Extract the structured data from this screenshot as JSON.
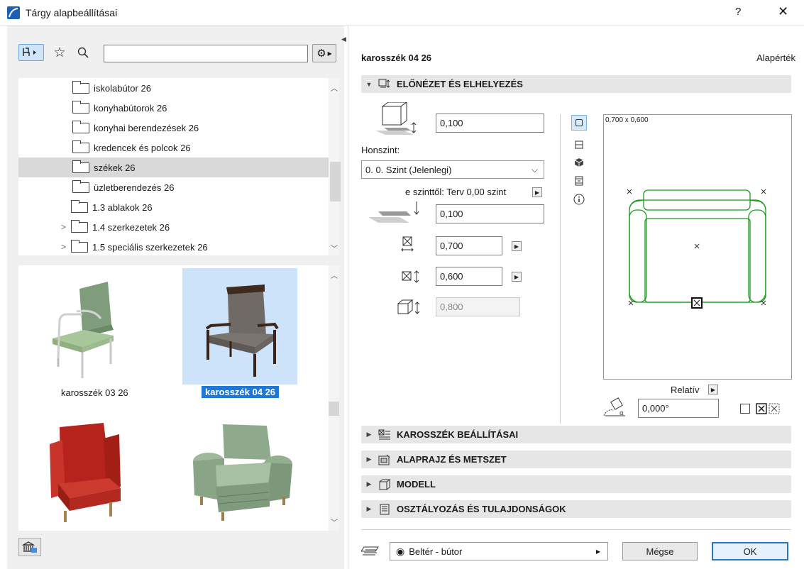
{
  "window": {
    "title": "Tárgy alapbeállításai",
    "help": "?",
    "close": "✕"
  },
  "tree": {
    "items": [
      {
        "label": "iskolabútor 26",
        "level": 3,
        "expander": ""
      },
      {
        "label": "konyhabútorok 26",
        "level": 3,
        "expander": ""
      },
      {
        "label": "konyhai berendezések 26",
        "level": 3,
        "expander": ""
      },
      {
        "label": "kredencek és polcok 26",
        "level": 3,
        "expander": ""
      },
      {
        "label": "székek 26",
        "level": 3,
        "expander": "",
        "selected": true
      },
      {
        "label": "üzletberendezés 26",
        "level": 3,
        "expander": ""
      },
      {
        "label": "1.3 ablakok 26",
        "level": 2,
        "expander": ""
      },
      {
        "label": "1.4 szerkezetek 26",
        "level": 2,
        "expander": ">"
      },
      {
        "label": "1.5 speciális szerkezetek 26",
        "level": 2,
        "expander": ">"
      }
    ]
  },
  "gallery": {
    "items": [
      {
        "caption": "karosszék 03 26",
        "selected": false
      },
      {
        "caption": "karosszék 04 26",
        "selected": true
      },
      {
        "caption": "",
        "selected": false
      },
      {
        "caption": "",
        "selected": false
      }
    ]
  },
  "object": {
    "name": "karosszék 04 26",
    "default_label": "Alapérték"
  },
  "sections": {
    "preview": "ELŐNÉZET ÉS ELHELYEZÉS",
    "settings": "KAROSSZÉK BEÁLLÍTÁSAI",
    "floorplan": "ALAPRAJZ ÉS METSZET",
    "model": "MODELL",
    "classification": "OSZTÁLYOZÁS ÉS TULAJDONSÁGOK"
  },
  "placement": {
    "offset_value": "0,100",
    "home_story_label": "Honszint:",
    "home_story_value": "0. 0. Szint (Jelenlegi)",
    "from_story_label": "e szinttől: Terv 0,00 szint",
    "from_story_value": "0,100",
    "width_value": "0,700",
    "depth_value": "0,600",
    "height_value": "0,800"
  },
  "preview": {
    "size_label": "0,700 x 0,600",
    "relative_label": "Relatív",
    "angle_value": "0,000°"
  },
  "footer": {
    "layer_label": "Beltér - bútor",
    "cancel_label": "Mégse",
    "ok_label": "OK"
  },
  "colors": {
    "accent": "#1e78d6",
    "plan_line": "#1a9a1a",
    "selection_bg": "#cce3fa"
  }
}
